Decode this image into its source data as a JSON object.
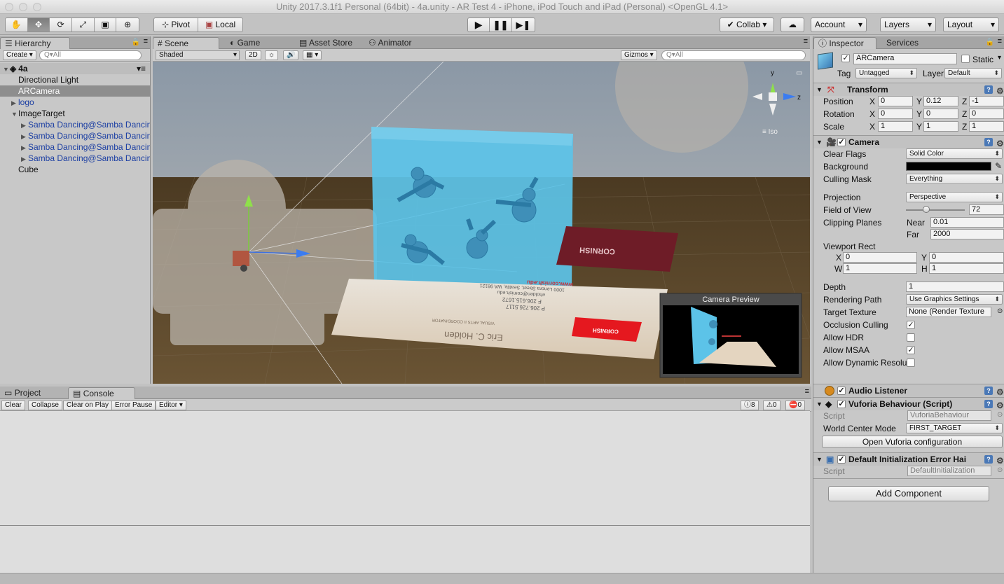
{
  "window": {
    "title": "Unity 2017.3.1f1 Personal (64bit) - 4a.unity - AR Test 4 - iPhone, iPod Touch and iPad (Personal) <OpenGL 4.1>"
  },
  "toolbar": {
    "tools": [
      "hand-icon",
      "move-icon",
      "rotate-icon",
      "scale-icon",
      "rect-icon",
      "transform-icon"
    ],
    "pivot_label": "Pivot",
    "local_label": "Local",
    "collab_label": "Collab",
    "account_label": "Account",
    "layers_label": "Layers",
    "layout_label": "Layout"
  },
  "hierarchy": {
    "tab": "Hierarchy",
    "create_label": "Create",
    "search_placeholder": "Q▾All",
    "scene_name": "4a",
    "items": [
      {
        "label": "Directional Light",
        "indent": 1,
        "arrow": ""
      },
      {
        "label": "ARCamera",
        "indent": 1,
        "arrow": "",
        "selected": true
      },
      {
        "label": "logo",
        "indent": 1,
        "arrow": "▶",
        "blue": true
      },
      {
        "label": "ImageTarget",
        "indent": 1,
        "arrow": "▼"
      },
      {
        "label": "Samba Dancing@Samba Dancing",
        "indent": 2,
        "arrow": "▶",
        "blue": true
      },
      {
        "label": "Samba Dancing@Samba Dancing",
        "indent": 2,
        "arrow": "▶",
        "blue": true
      },
      {
        "label": "Samba Dancing@Samba Dancing",
        "indent": 2,
        "arrow": "▶",
        "blue": true
      },
      {
        "label": "Samba Dancing@Samba Dancing",
        "indent": 2,
        "arrow": "▶",
        "blue": true
      },
      {
        "label": "Cube",
        "indent": 1,
        "arrow": ""
      }
    ]
  },
  "scene": {
    "tabs": [
      "Scene",
      "Game",
      "Asset Store",
      "Animator"
    ],
    "shading": "Shaded",
    "mode_2d": "2D",
    "gizmos_label": "Gizmos",
    "search_placeholder": "Q▾All",
    "iso_label": "≡ Iso",
    "camera_preview_label": "Camera Preview",
    "axis_y": "y",
    "axis_z": "z",
    "card_text": {
      "name": "Eric C. Holden",
      "sub": "VISUAL ARTS II COORDINATOR",
      "phone1": "P  206.726.5117",
      "phone2": "F  206.615.1672",
      "email": "eholden@cornish.edu",
      "addr": "1000 Lenora Street, Seattle, WA 98121",
      "web": "www.cornish.edu",
      "logo": "CORNISH",
      "back": "CORNISH"
    }
  },
  "bottom": {
    "tabs": [
      "Project",
      "Console"
    ],
    "buttons": [
      "Clear",
      "Collapse",
      "Clear on Play",
      "Error Pause",
      "Editor"
    ],
    "counts": {
      "logs": "8",
      "warnings": "0",
      "errors": "0"
    }
  },
  "inspector": {
    "tabs": [
      "Inspector",
      "Services"
    ],
    "object_name": "ARCamera",
    "static_label": "Static",
    "tag_label": "Tag",
    "tag_value": "Untagged",
    "layer_label": "Layer",
    "layer_value": "Default",
    "transform": {
      "title": "Transform",
      "position": {
        "label": "Position",
        "x": "0",
        "y": "0.12",
        "z": "-1"
      },
      "rotation": {
        "label": "Rotation",
        "x": "0",
        "y": "0",
        "z": "0"
      },
      "scale": {
        "label": "Scale",
        "x": "1",
        "y": "1",
        "z": "1"
      }
    },
    "camera": {
      "title": "Camera",
      "clear_flags": {
        "label": "Clear Flags",
        "value": "Solid Color"
      },
      "background": {
        "label": "Background",
        "color": "#000000"
      },
      "culling_mask": {
        "label": "Culling Mask",
        "value": "Everything"
      },
      "projection": {
        "label": "Projection",
        "value": "Perspective"
      },
      "fov": {
        "label": "Field of View",
        "value": "72",
        "fraction": 0.35
      },
      "clipping": {
        "label": "Clipping Planes",
        "near_label": "Near",
        "near": "0.01",
        "far_label": "Far",
        "far": "2000"
      },
      "viewport": {
        "label": "Viewport Rect",
        "x": "0",
        "y": "0",
        "w": "1",
        "h": "1"
      },
      "depth": {
        "label": "Depth",
        "value": "1"
      },
      "rendering_path": {
        "label": "Rendering Path",
        "value": "Use Graphics Settings"
      },
      "target_texture": {
        "label": "Target Texture",
        "value": "None (Render Texture"
      },
      "occlusion": {
        "label": "Occlusion Culling",
        "checked": true
      },
      "hdr": {
        "label": "Allow HDR",
        "checked": false
      },
      "msaa": {
        "label": "Allow MSAA",
        "checked": true
      },
      "dynres": {
        "label": "Allow Dynamic Resolu",
        "checked": false
      }
    },
    "audio_listener": {
      "title": "Audio Listener"
    },
    "vuforia": {
      "title": "Vuforia Behaviour (Script)",
      "script_label": "Script",
      "script_value": "VuforiaBehaviour",
      "wcm_label": "World Center Mode",
      "wcm_value": "FIRST_TARGET",
      "open_config": "Open Vuforia configuration"
    },
    "default_init": {
      "title": "Default Initialization Error Hai",
      "script_label": "Script",
      "script_value": "DefaultInitialization"
    },
    "add_component": "Add Component"
  }
}
